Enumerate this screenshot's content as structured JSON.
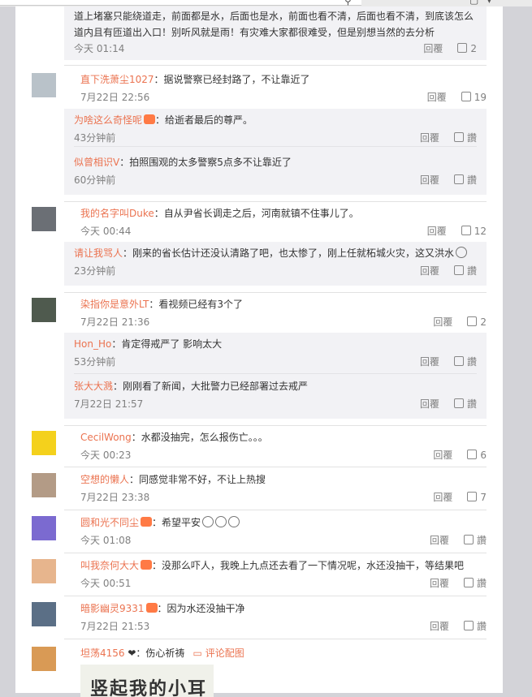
{
  "top": {
    "post_continuation": {
      "text_line1": "道上堵塞只能绕道走，前面都是水，后面也是水，前面也看不清，后面也看不清，到底该怎么走",
      "text_line2": "道内且有匝道出入口！别听风就是雨！有灾难大家都很难受，但是别想当然的去分析",
      "time": "今天 01:14",
      "reply_label": "回覆",
      "likes": "2"
    }
  },
  "comments": [
    {
      "name": "直下洗萧尘1027",
      "text": "：据说警察已经封路了，不让靠近了",
      "time": "7月22日 22:56",
      "reply_label": "回覆",
      "likes": "19",
      "avatar_color": "#b9c2c9",
      "replies": [
        {
          "name": "为啥这么奇怪呢",
          "text": "：给逝者最后的尊严。",
          "time": "43分钟前",
          "reply_label": "回覆",
          "likes": "讚"
        },
        {
          "name": "似曾相识V",
          "text": "：拍照围观的太多警察5点多不让靠近了",
          "time": "60分钟前",
          "reply_label": "回覆",
          "likes": "讚"
        }
      ]
    },
    {
      "name": "我的名字叫Duke",
      "text": "：自从尹省长调走之后，河南就镇不住事儿了。",
      "time": "今天 00:44",
      "reply_label": "回覆",
      "likes": "12",
      "avatar_color": "#6b6f75",
      "replies": [
        {
          "name": "请让我骂人",
          "text": "：刚来的省长估计还没认清路了吧，也太惨了，刚上任就柘城火灾，这又洪水",
          "time": "23分钟前",
          "reply_label": "回覆",
          "likes": "讚"
        }
      ]
    },
    {
      "name": "染指你是意外LT",
      "text": "：看视频已经有3个了",
      "time": "7月22日 21:36",
      "reply_label": "回覆",
      "likes": "2",
      "avatar_color": "#4f5a4e",
      "replies": [
        {
          "name": "Hon_Ho",
          "text": "：肯定得戒严了 影响太大",
          "time": "53分钟前",
          "reply_label": "回覆",
          "likes": "讚"
        },
        {
          "name": "张大大溅",
          "text": "：刚刚看了新闻，大批警力已经部署过去戒严",
          "time": "7月22日 21:57",
          "reply_label": "回覆",
          "likes": "讚"
        }
      ]
    },
    {
      "name": "CecilWong",
      "text": "：水都没抽完，怎么报伤亡。。。",
      "time": "今天 00:23",
      "reply_label": "回覆",
      "likes": "6",
      "avatar_color": "#f4d11c",
      "replies": []
    },
    {
      "name": "空想的懒人",
      "text": "：同感觉非常不好，不让上热搜",
      "time": "7月22日 23:38",
      "reply_label": "回覆",
      "likes": "7",
      "avatar_color": "#b39b86",
      "replies": []
    },
    {
      "name": "圆和光不同尘",
      "text": "：希望平安",
      "time": "今天 01:08",
      "reply_label": "回覆",
      "likes": "讚",
      "avatar_color": "#7b6ad0",
      "replies": []
    },
    {
      "name": "叫我奈何大大",
      "text": "：没那么吓人，我晚上九点还去看了一下情况呢，水还没抽干，等结果吧",
      "time": "今天 00:51",
      "reply_label": "回覆",
      "likes": "讚",
      "avatar_color": "#e7b58d",
      "replies": []
    },
    {
      "name": "暗影幽灵9331",
      "text": "：因为水还没抽干净",
      "time": "7月22日 21:53",
      "reply_label": "回覆",
      "likes": "讚",
      "avatar_color": "#5b6f86",
      "replies": []
    }
  ],
  "last_comment": {
    "name": "坦荡4156",
    "text": "：伤心祈祷",
    "pic_comment_label": "评论配图",
    "image_text": "竖起我的小耳朵",
    "avatar_color": "#d99a55"
  }
}
